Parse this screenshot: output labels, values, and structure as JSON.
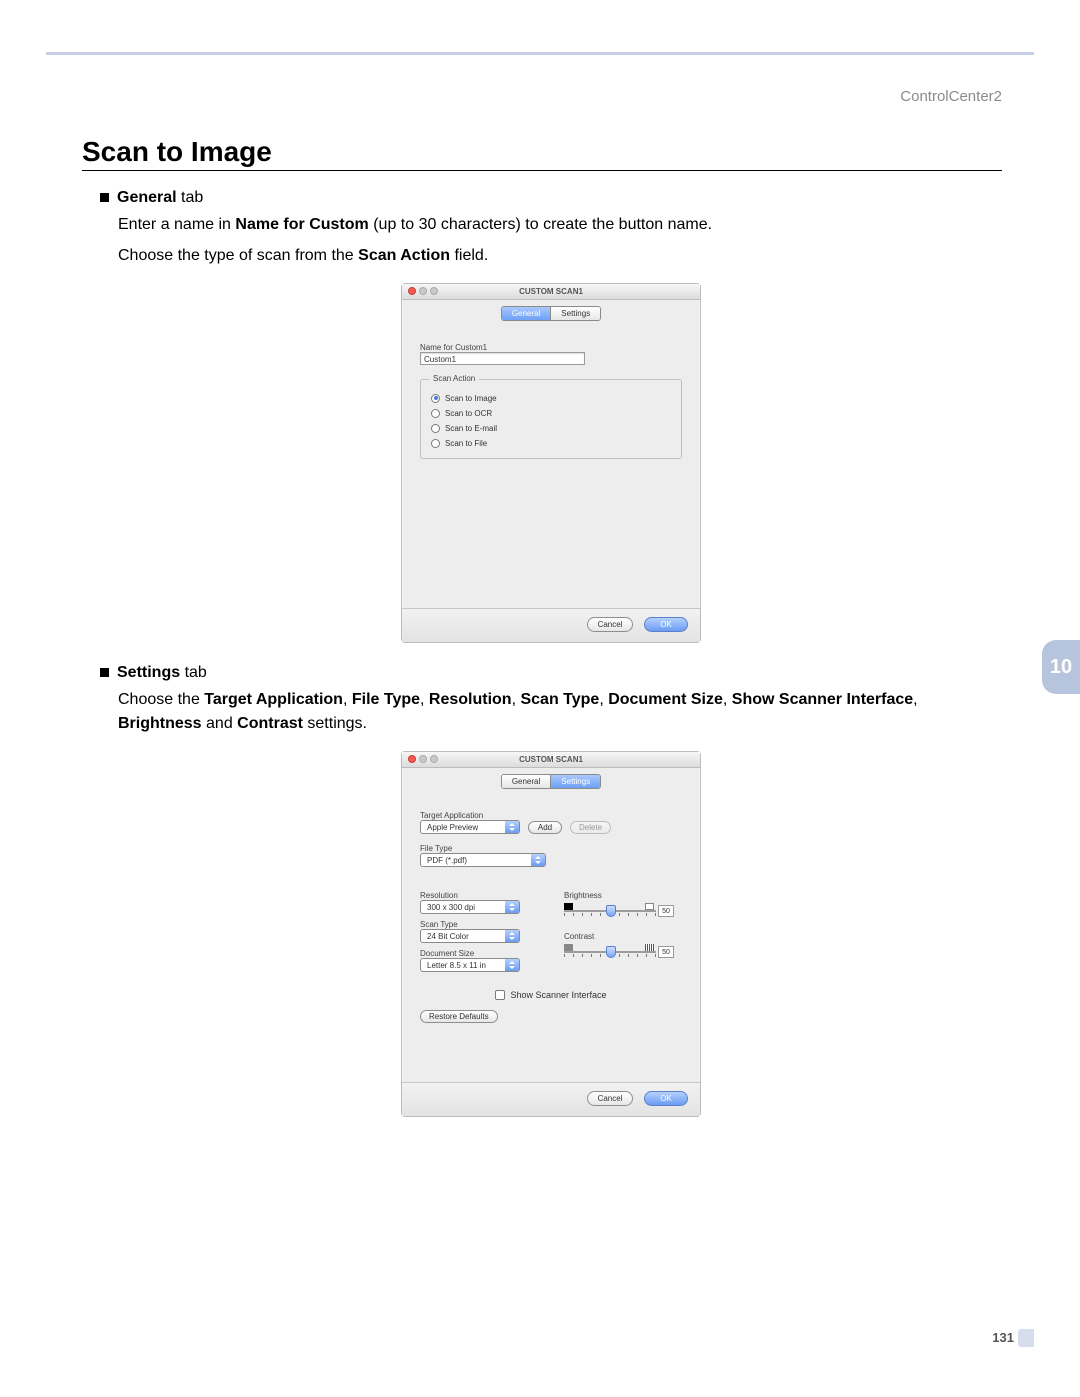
{
  "header": {
    "right": "ControlCenter2"
  },
  "title": "Scan to Image",
  "section1": {
    "bullet_label_bold": "General",
    "bullet_label_rest": " tab",
    "p1_a": "Enter a name in ",
    "p1_b": "Name for Custom",
    "p1_c": " (up to 30 characters) to create the button name.",
    "p2_a": "Choose the type of scan from the ",
    "p2_b": "Scan Action",
    "p2_c": " field."
  },
  "dialog1": {
    "title": "CUSTOM SCAN1",
    "tab_general": "General",
    "tab_settings": "Settings",
    "name_label": "Name for Custom1",
    "name_value": "Custom1",
    "scan_action_legend": "Scan Action",
    "opt_image": "Scan to Image",
    "opt_ocr": "Scan to OCR",
    "opt_email": "Scan to E-mail",
    "opt_file": "Scan to File",
    "cancel": "Cancel",
    "ok": "OK"
  },
  "section2": {
    "bullet_label_bold": "Settings",
    "bullet_label_rest": " tab",
    "p_a": "Choose the ",
    "p_b": "Target Application",
    "p_c": ", ",
    "p_d": "File Type",
    "p_e": ", ",
    "p_f": "Resolution",
    "p_g": ", ",
    "p_h": "Scan Type",
    "p_i": ", ",
    "p_j": "Document Size",
    "p_k": ", ",
    "p_l": "Show Scanner Interface",
    "p_m": ", ",
    "p_n": "Brightness",
    "p_o": " and ",
    "p_p": "Contrast",
    "p_q": " settings."
  },
  "dialog2": {
    "title": "CUSTOM SCAN1",
    "tab_general": "General",
    "tab_settings": "Settings",
    "target_label": "Target Application",
    "target_value": "Apple Preview",
    "add": "Add",
    "delete": "Delete",
    "filetype_label": "File Type",
    "filetype_value": "PDF (*.pdf)",
    "resolution_label": "Resolution",
    "resolution_value": "300 x 300 dpi",
    "scantype_label": "Scan Type",
    "scantype_value": "24 Bit Color",
    "docsize_label": "Document Size",
    "docsize_value": "Letter  8.5 x 11 in",
    "brightness_label": "Brightness",
    "brightness_value": "50",
    "contrast_label": "Contrast",
    "contrast_value": "50",
    "show_scanner": "Show Scanner Interface",
    "restore": "Restore Defaults",
    "cancel": "Cancel",
    "ok": "OK"
  },
  "side_tab": "10",
  "page_number": "131"
}
